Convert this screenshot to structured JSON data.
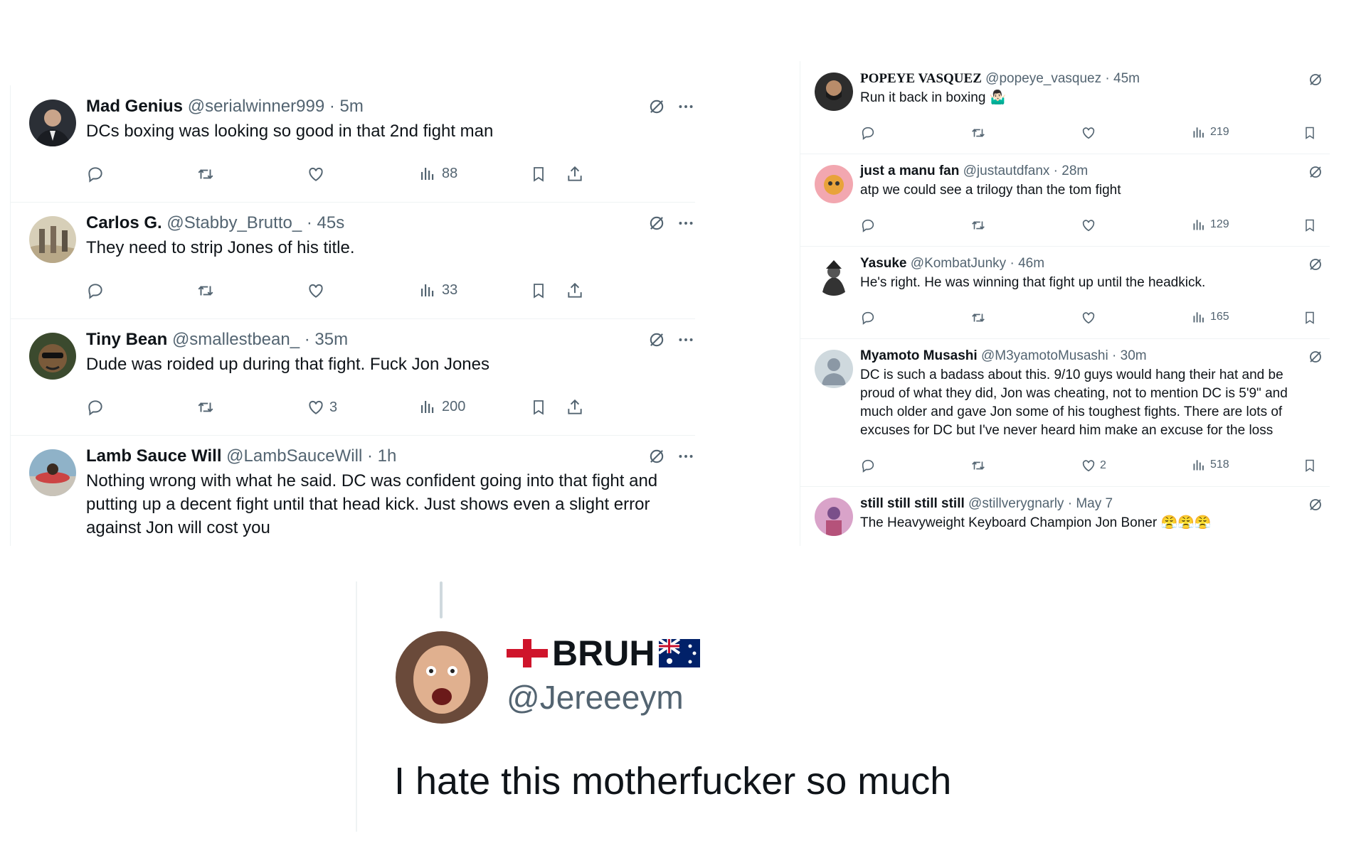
{
  "left_tweets": [
    {
      "name": "Mad Genius",
      "handle": "@serialwinner999",
      "sep": "·",
      "time": "5m",
      "text": "DCs boxing was looking so good in that 2nd fight man",
      "likes": "",
      "views": "88"
    },
    {
      "name": "Carlos G.",
      "handle": "@Stabby_Brutto_",
      "sep": "·",
      "time": "45s",
      "text": "They need to strip Jones of his title.",
      "likes": "",
      "views": "33"
    },
    {
      "name": "Tiny Bean",
      "handle": "@smallestbean_",
      "sep": "·",
      "time": "35m",
      "text": "Dude was roided up during that fight. Fuck Jon Jones",
      "likes": "3",
      "views": "200"
    },
    {
      "name": "Lamb Sauce Will",
      "handle": "@LambSauceWill",
      "sep": "·",
      "time": "1h",
      "text": "Nothing wrong with what he said. DC was confident going into that fight and putting up a decent fight until that head kick. Just shows even a slight error against Jon will cost you",
      "likes": "",
      "views": ""
    }
  ],
  "right_tweets": [
    {
      "name": "POPEYE VASQUEZ",
      "handle": "@popeye_vasquez",
      "sep": "·",
      "time": "45m",
      "text": "Run it back in boxing 🤷🏻‍♂️",
      "likes": "",
      "views": "219"
    },
    {
      "name": "just a manu fan",
      "handle": "@justautdfanx",
      "sep": "·",
      "time": "28m",
      "text": "atp we could see a trilogy than the tom fight",
      "likes": "",
      "views": "129"
    },
    {
      "name": "Yasuke",
      "handle": "@KombatJunky",
      "sep": "·",
      "time": "46m",
      "text": "He's right. He was winning that fight up until the headkick.",
      "likes": "",
      "views": "165"
    },
    {
      "name": "Myamoto Musashi",
      "handle": "@M3yamotoMusashi",
      "sep": "·",
      "time": "30m",
      "text": "DC is such a badass about this. 9/10 guys would hang their hat and be proud of what they did, Jon was cheating, not to mention DC is 5'9\" and much older and gave Jon some of his toughest fights. There are lots of excuses for DC but I've never heard him make an excuse for the loss",
      "likes": "2",
      "views": "518"
    },
    {
      "name": "still still still still",
      "handle": "@stillverygnarly",
      "sep": "·",
      "time": "May 7",
      "text": "The Heavyweight Keyboard Champion Jon Boner 😤😤😤",
      "likes": "",
      "views": ""
    }
  ],
  "quote": {
    "name": "BRUH",
    "handle": "@Jereeeym",
    "text": "I hate this motherfucker so much"
  },
  "colors": {
    "text": "#0f1419",
    "muted": "#536471",
    "border": "#eff3f4"
  },
  "icons": [
    "reply-icon",
    "retweet-icon",
    "like-icon",
    "views-icon",
    "bookmark-icon",
    "share-icon",
    "grok-icon",
    "more-icon"
  ]
}
